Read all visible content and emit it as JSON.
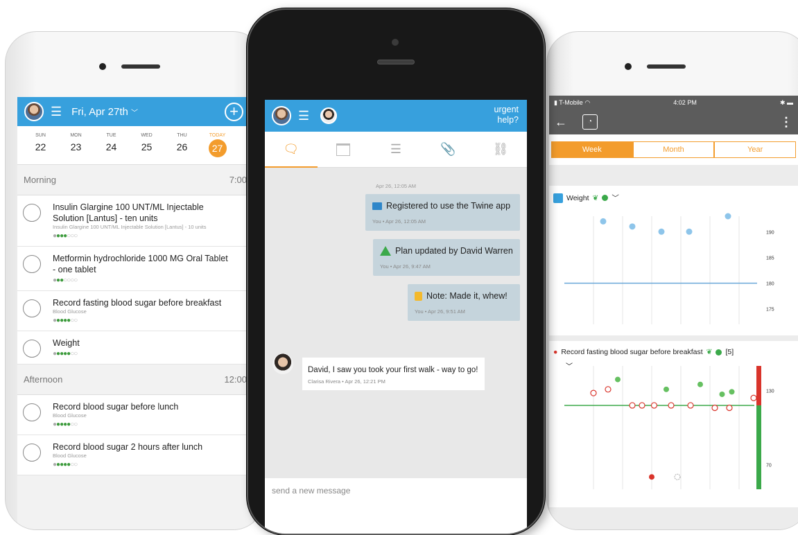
{
  "left": {
    "header": {
      "date": "Fri, Apr 27th"
    },
    "week": [
      {
        "name": "SUN",
        "num": "22"
      },
      {
        "name": "MON",
        "num": "23"
      },
      {
        "name": "TUE",
        "num": "24"
      },
      {
        "name": "WED",
        "num": "25"
      },
      {
        "name": "THU",
        "num": "26"
      },
      {
        "name": "TODAY",
        "num": "27"
      }
    ],
    "sections": [
      {
        "label": "Morning",
        "time": "7:00",
        "tasks": [
          {
            "title": "Insulin Glargine 100 UNT/ML Injectable Solution [Lantus] - ten units",
            "sub": "Insulin Glargine 100 UNT/ML Injectable Solution [Lantus] - 10 units",
            "done": 3,
            "total": 6,
            "edge": "#cfd8de"
          },
          {
            "title": "Metformin hydrochloride 1000 MG Oral Tablet - one tablet",
            "sub": "",
            "done": 2,
            "total": 6,
            "edge": "#7aa7cf"
          },
          {
            "title": "Record fasting blood sugar before breakfast",
            "sub": "Blood Glucose",
            "done": 4,
            "total": 6,
            "edge": "#d9342b"
          },
          {
            "title": "Weight",
            "sub": "",
            "done": 4,
            "total": 6,
            "edge": "#2e86c9"
          }
        ]
      },
      {
        "label": "Afternoon",
        "time": "12:00",
        "tasks": [
          {
            "title": "Record blood sugar before lunch",
            "sub": "Blood Glucose",
            "done": 4,
            "total": 6,
            "edge": "#d9342b"
          },
          {
            "title": "Record blood sugar 2 hours after lunch",
            "sub": "Blood Glucose",
            "done": 4,
            "total": 6,
            "edge": "#d9342b"
          }
        ]
      }
    ]
  },
  "mid": {
    "urgent": "urgent help?",
    "tabs": [
      {
        "icon": "chat-icon",
        "active": true
      },
      {
        "icon": "calendar-icon"
      },
      {
        "icon": "notes-icon"
      },
      {
        "icon": "paperclip-icon"
      },
      {
        "icon": "link-icon"
      }
    ],
    "timestamp": "Apr 26, 12:05 AM",
    "messages": [
      {
        "icon": "flag-icon",
        "text": "Registered to use the Twine app",
        "meta": "You • Apr 26, 12:05 AM"
      },
      {
        "icon": "triangle-icon",
        "text": "Plan updated by David Warren",
        "meta": "You • Apr 26, 9:47 AM"
      },
      {
        "icon": "note-icon",
        "text": "Note: Made it, whew!",
        "meta": "You • Apr 26, 9:51 AM"
      }
    ],
    "incoming": {
      "text": "David, I saw you took your first walk - way to go!",
      "meta": "Clarisa Rivera • Apr 26, 12:21 PM"
    },
    "input_placeholder": "send a new message"
  },
  "right": {
    "status": {
      "carrier": "T-Mobile",
      "time": "4:02 PM"
    },
    "segments": [
      {
        "label": "Week",
        "active": true
      },
      {
        "label": "Month"
      },
      {
        "label": "Year"
      }
    ],
    "weight_card": {
      "title": "Weight"
    },
    "glucose_card": {
      "title": "Record fasting blood sugar before breakfast",
      "count": "[5]"
    },
    "colors": {
      "accent": "#f39c2c",
      "blue": "#37a0dd",
      "green": "#3ba94a",
      "red": "#d9342b"
    }
  },
  "chart_data": [
    {
      "type": "scatter",
      "title": "Weight",
      "y_ticks": [
        "190",
        "185",
        "180",
        "175"
      ],
      "ylim": [
        172,
        193
      ],
      "x": [
        1,
        2,
        3,
        4,
        5,
        6
      ],
      "values": [
        192,
        191,
        190,
        190,
        null,
        193
      ],
      "goal": 180
    },
    {
      "type": "scatter",
      "title": "Record fasting blood sugar before breakfast",
      "y_ticks": [
        "130",
        "70"
      ],
      "goal": 118,
      "series": [
        {
          "marker": "open-red",
          "points": [
            [
              1.1,
              128
            ],
            [
              1.4,
              131
            ],
            [
              1.9,
              118
            ],
            [
              2.1,
              118
            ],
            [
              2.35,
              118
            ],
            [
              2.7,
              118
            ],
            [
              3.1,
              118
            ],
            [
              3.6,
              116
            ],
            [
              3.9,
              116
            ],
            [
              4.4,
              124
            ]
          ]
        },
        {
          "marker": "filled-green",
          "points": [
            [
              1.6,
              139
            ],
            [
              2.6,
              131
            ],
            [
              3.3,
              135
            ],
            [
              3.75,
              127
            ],
            [
              3.95,
              129
            ]
          ]
        },
        {
          "marker": "filled-red",
          "points": [
            [
              2.3,
              60
            ]
          ]
        }
      ]
    }
  ]
}
